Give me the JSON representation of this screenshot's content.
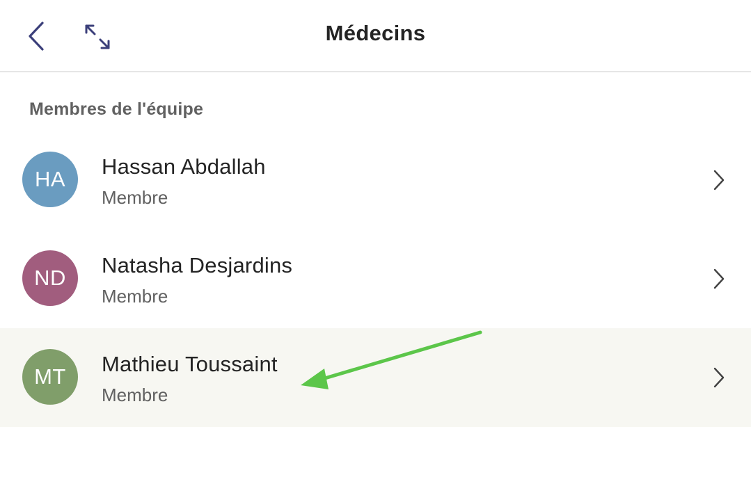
{
  "header": {
    "title": "Médecins",
    "back_icon": "chevron-left-icon",
    "expand_icon": "expand-arrows-icon"
  },
  "section": {
    "label": "Membres de l'équipe"
  },
  "members": [
    {
      "initials": "HA",
      "name": "Hassan Abdallah",
      "role": "Membre",
      "avatar_color": "#6a9cc0"
    },
    {
      "initials": "ND",
      "name": "Natasha Desjardins",
      "role": "Membre",
      "avatar_color": "#a15d7e"
    },
    {
      "initials": "MT",
      "name": "Mathieu Toussaint",
      "role": "Membre",
      "avatar_color": "#809e6a"
    }
  ],
  "colors": {
    "accent": "#3b3f7a",
    "highlight_row": "#f7f7f2",
    "annotation_arrow": "#5cc64a"
  }
}
